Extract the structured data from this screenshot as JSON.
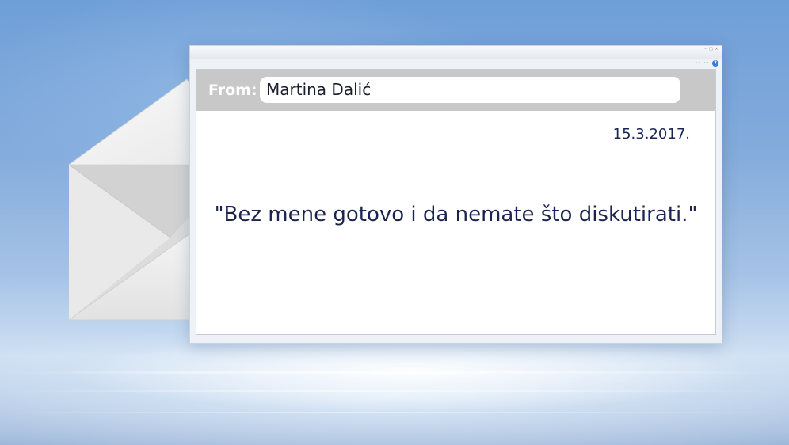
{
  "window": {
    "controls": [
      "–",
      "□",
      "×"
    ],
    "help_icon": "?",
    "toolbar_dots": "•• ••"
  },
  "mail": {
    "from_label": "From:",
    "from_value": "Martina Dalić",
    "date": "15.3.2017.",
    "body": "\"Bez mene gotovo i da nemate što diskutirati.\""
  },
  "icons": {
    "envelope": "envelope-icon",
    "help": "help-icon"
  },
  "colors": {
    "text_navy": "#1b2450",
    "from_bar": "#c8c8c8",
    "help_blue": "#3a7bd5"
  }
}
